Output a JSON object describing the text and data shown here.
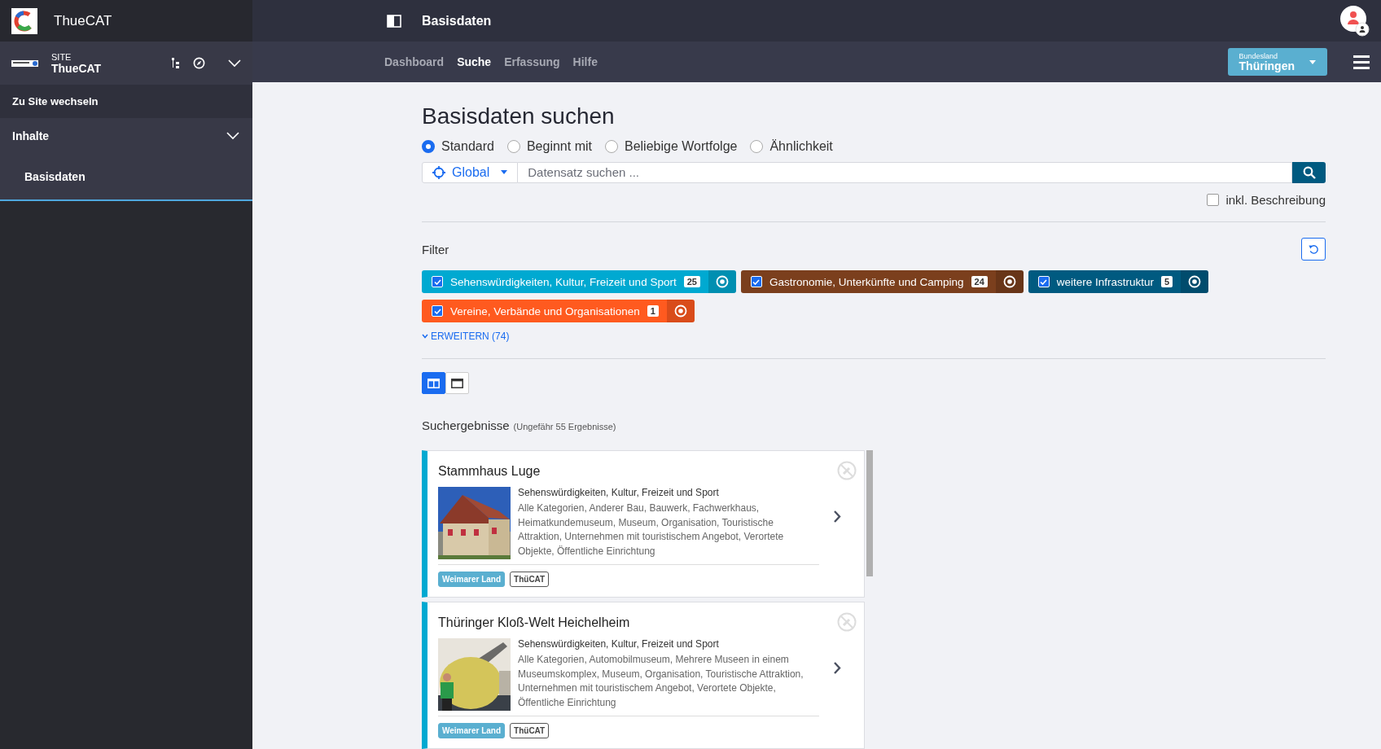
{
  "app": {
    "name": "ThueCAT"
  },
  "site": {
    "label": "SITE",
    "name": "ThueCAT"
  },
  "sidebar": {
    "switch_site": "Zu Site wechseln",
    "section": {
      "label": "Inhalte",
      "expanded": true,
      "items": [
        {
          "label": "Basisdaten",
          "selected": true
        }
      ]
    }
  },
  "header": {
    "title": "Basisdaten"
  },
  "nav": [
    {
      "label": "Dashboard",
      "selected": false
    },
    {
      "label": "Suche",
      "selected": true
    },
    {
      "label": "Erfassung",
      "selected": false
    },
    {
      "label": "Hilfe",
      "selected": false
    }
  ],
  "region": {
    "label": "Bundesland",
    "value": "Thüringen"
  },
  "page": {
    "title": "Basisdaten suchen",
    "modes": [
      {
        "label": "Standard",
        "selected": true
      },
      {
        "label": "Beginnt mit",
        "selected": false
      },
      {
        "label": "Beliebige Wortfolge",
        "selected": false
      },
      {
        "label": "Ähnlichkeit",
        "selected": false
      }
    ],
    "scope": "Global",
    "search": {
      "placeholder": "Datensatz suchen ..."
    },
    "include_description": {
      "label": "inkl. Beschreibung",
      "checked": false
    },
    "filter": {
      "title": "Filter",
      "expand": "ERWEITERN (74)",
      "chips": [
        {
          "label": "Sehenswürdigkeiten, Kultur, Freizeit und Sport",
          "count": "25",
          "color": "#00a9d1",
          "checked": true
        },
        {
          "label": "Gastronomie, Unterkünfte und Camping",
          "count": "24",
          "color": "#7b3f1d",
          "checked": true
        },
        {
          "label": "weitere Infrastruktur",
          "count": "5",
          "color": "#005a80",
          "checked": true
        },
        {
          "label": "Vereine, Verbände und Organisationen",
          "count": "1",
          "color": "#ff5a1f",
          "checked": true
        }
      ]
    },
    "views": [
      {
        "kind": "split",
        "selected": true
      },
      {
        "kind": "full",
        "selected": false
      }
    ],
    "results": {
      "title": "Suchergebnisse",
      "count": "(Ungefähr 55 Ergebnisse)",
      "items": [
        {
          "title": "Stammhaus Luge",
          "category": "Sehenswürdigkeiten, Kultur, Freizeit und Sport",
          "tags": "Alle Kategorien, Anderer Bau, Bauwerk, Fachwerkhaus, Heimatkundemuseum, Museum, Organisation, Touristische Attraktion, Unternehmen mit touristischem Angebot, Verortete Objekte, Öffentliche Einrichtung",
          "badges": [
            {
              "label": "Weimarer Land",
              "kind": "filled"
            },
            {
              "label": "ThüCAT",
              "kind": "outline"
            }
          ]
        },
        {
          "title": "Thüringer Kloß-Welt Heichelheim",
          "category": "Sehenswürdigkeiten, Kultur, Freizeit und Sport",
          "tags": "Alle Kategorien, Automobilmuseum, Mehrere Museen in einem Museumskomplex, Museum, Organisation, Touristische Attraktion, Unternehmen mit touristischem Angebot, Verortete Objekte, Öffentliche Einrichtung",
          "badges": [
            {
              "label": "Weimarer Land",
              "kind": "filled"
            },
            {
              "label": "ThüCAT",
              "kind": "outline"
            }
          ]
        }
      ]
    }
  }
}
